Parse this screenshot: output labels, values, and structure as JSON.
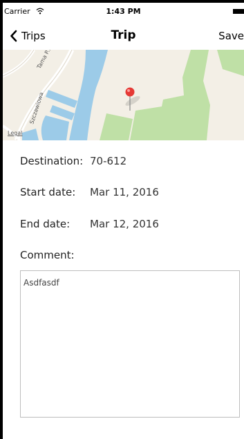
{
  "status_bar": {
    "carrier": "Carrier",
    "time": "1:43 PM",
    "wifi_icon": "wifi-icon",
    "battery_icon": "battery-icon"
  },
  "nav": {
    "back_label": "Trips",
    "back_icon": "chevron-left-icon",
    "title": "Trip",
    "save_label": "Save"
  },
  "map": {
    "street_label_1": "Tama P...",
    "street_label_2": "Szczawiowa",
    "legal_label": "Legal",
    "pin_icon": "map-pin-icon",
    "colors": {
      "land": "#f3efe6",
      "water": "#9ccbe8",
      "park": "#bfe0a6",
      "pin": "#e53935"
    }
  },
  "form": {
    "destination_label": "Destination:",
    "destination_value": "70-612",
    "start_label": "Start date:",
    "start_value": "Mar 11, 2016",
    "end_label": "End date:",
    "end_value": "Mar 12, 2016",
    "comment_label": "Comment:",
    "comment_value": "Asdfasdf"
  }
}
